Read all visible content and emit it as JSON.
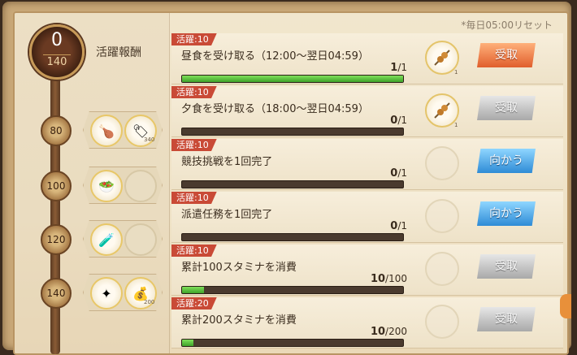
{
  "reset_note": "*毎日05:00リセット",
  "activity": {
    "title": "活躍報酬",
    "current": "0",
    "total": "140"
  },
  "milestones": [
    {
      "value": "80",
      "rewards": [
        {
          "icon": "roast-chicken-icon",
          "glyph": "🍗",
          "qty": ""
        },
        {
          "icon": "tag-icon",
          "glyph": "🏷",
          "qty": "340"
        }
      ]
    },
    {
      "value": "100",
      "rewards": [
        {
          "icon": "salad-bowl-icon",
          "glyph": "🥗",
          "qty": ""
        },
        {
          "icon": "empty",
          "glyph": "",
          "qty": ""
        }
      ]
    },
    {
      "value": "120",
      "rewards": [
        {
          "icon": "potion-icon",
          "glyph": "🧪",
          "qty": ""
        },
        {
          "icon": "empty",
          "glyph": "",
          "qty": ""
        }
      ]
    },
    {
      "value": "140",
      "rewards": [
        {
          "icon": "crystal-icon",
          "glyph": "✦",
          "qty": ""
        },
        {
          "icon": "coins-icon",
          "glyph": "💰",
          "qty": "200"
        }
      ]
    }
  ],
  "tasks": [
    {
      "tag": "活躍:10",
      "name": "昼食を受け取る（12:00～翌日04:59）",
      "done": "1",
      "goal": "1",
      "progress": 1.0,
      "icon": "skewer-icon",
      "item_qty": "1",
      "action": "受取",
      "action_state": "claim"
    },
    {
      "tag": "活躍:10",
      "name": "夕食を受け取る（18:00～翌日04:59）",
      "done": "0",
      "goal": "1",
      "progress": 0.0,
      "icon": "skewer-icon",
      "item_qty": "1",
      "action": "受取",
      "action_state": "disabled"
    },
    {
      "tag": "活躍:10",
      "name": "競技挑戦を1回完了",
      "done": "0",
      "goal": "1",
      "progress": 0.0,
      "icon": "ghost",
      "item_qty": "",
      "action": "向かう",
      "action_state": "go"
    },
    {
      "tag": "活躍:10",
      "name": "派遣任務を1回完了",
      "done": "0",
      "goal": "1",
      "progress": 0.0,
      "icon": "ghost",
      "item_qty": "",
      "action": "向かう",
      "action_state": "go"
    },
    {
      "tag": "活躍:10",
      "name": "累計100スタミナを消費",
      "done": "10",
      "goal": "100",
      "progress": 0.1,
      "icon": "ghost",
      "item_qty": "",
      "action": "受取",
      "action_state": "disabled"
    },
    {
      "tag": "活躍:20",
      "name": "累計200スタミナを消費",
      "done": "10",
      "goal": "200",
      "progress": 0.05,
      "icon": "ghost",
      "item_qty": "",
      "action": "受取",
      "action_state": "disabled"
    }
  ]
}
